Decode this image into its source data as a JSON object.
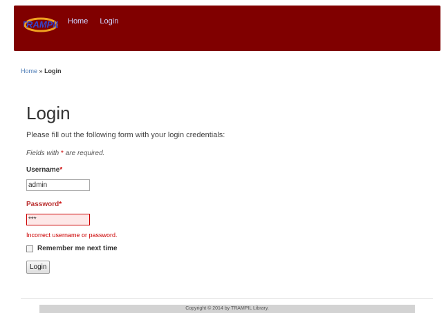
{
  "header": {
    "logo_text": "TRAMPIL",
    "nav": [
      "Home",
      "Login"
    ]
  },
  "breadcrumb": {
    "home": "Home",
    "separator": "»",
    "current": "Login"
  },
  "main": {
    "title": "Login",
    "intro": "Please fill out the following form with your login credentials:",
    "required_note_prefix": "Fields with",
    "required_note_star": "*",
    "required_note_suffix": "are required.",
    "username_label": "Username",
    "username_value": "admin",
    "password_label": "Password",
    "password_value": "***",
    "required_mark": "*",
    "error_message": "Incorrect username or password.",
    "remember_label": "Remember me next time",
    "login_button": "Login"
  },
  "footer": {
    "copyright": "Copyright © 2014 by TRAMPIL Library."
  },
  "colors": {
    "header_bg": "#800000",
    "error": "#cc0000",
    "link": "#4a7ab5"
  }
}
